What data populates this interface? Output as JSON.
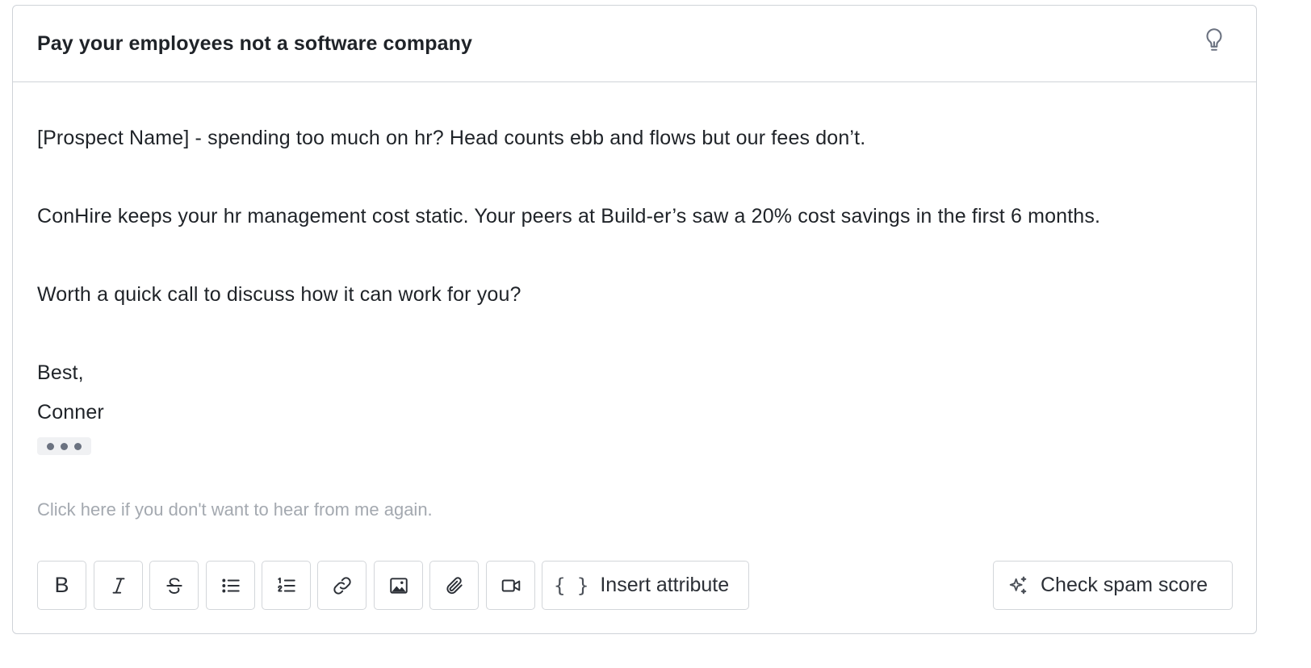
{
  "subject": "Pay your employees not a software company",
  "body_lines": [
    "[Prospect Name] - spending too much on hr? Head counts ebb and flows but our fees don’t.",
    "ConHire keeps your hr management cost static. Your peers at Build-er’s saw a 20% cost savings in the first 6 months.",
    "Worth a quick call to discuss how it can work for you?",
    "Best,",
    "Conner"
  ],
  "unsubscribe_text": "Click here if you don't want to hear from me again.",
  "toolbar": {
    "bold_label": "B",
    "buttons": [
      "bold-icon",
      "italic-icon",
      "strikethrough-icon",
      "bullet-list-icon",
      "numbered-list-icon",
      "link-icon",
      "image-icon",
      "attachment-icon",
      "video-icon"
    ],
    "insert_attribute_label": "Insert attribute",
    "check_spam_label": "Check spam score"
  }
}
